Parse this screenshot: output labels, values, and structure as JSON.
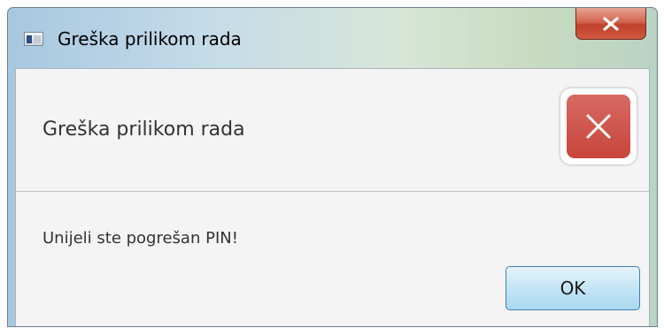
{
  "window": {
    "title": "Greška prilikom rada"
  },
  "dialog": {
    "header": "Greška prilikom rada",
    "message": "Unijeli ste pogrešan PIN!",
    "ok_label": "OK",
    "icon": "error-icon"
  },
  "colors": {
    "error_red": "#c8453b",
    "close_red": "#c0412a",
    "ok_button_border": "#3c7fb1"
  }
}
